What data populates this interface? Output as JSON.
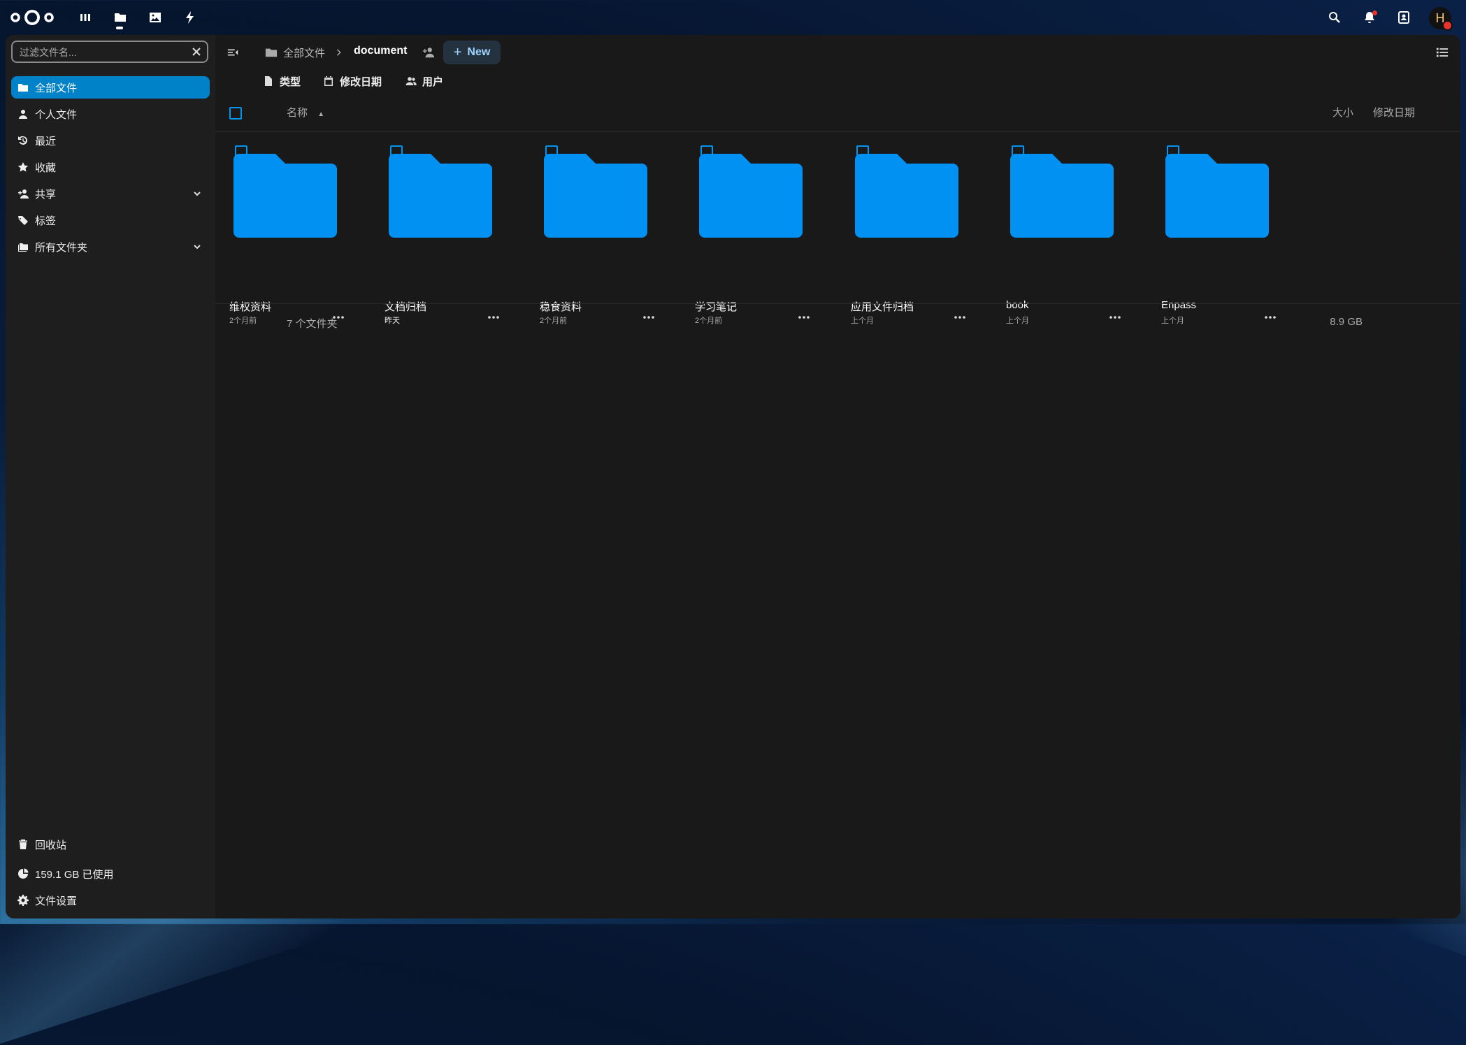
{
  "header": {
    "apps": [
      {
        "name": "dashboard",
        "icon": "dashboard-icon"
      },
      {
        "name": "files",
        "icon": "folder-icon"
      },
      {
        "name": "photos",
        "icon": "photo-icon"
      },
      {
        "name": "activity",
        "icon": "lightning-icon"
      }
    ],
    "avatar_initial": "H",
    "right_icons": [
      "search-icon",
      "bell-icon",
      "contacts-icon"
    ]
  },
  "sidebar": {
    "filter_placeholder": "过滤文件名...",
    "items": [
      {
        "label": "全部文件",
        "icon": "folder-icon",
        "active": true
      },
      {
        "label": "个人文件",
        "icon": "user-icon"
      },
      {
        "label": "最近",
        "icon": "history-icon"
      },
      {
        "label": "收藏",
        "icon": "star-icon"
      },
      {
        "label": "共享",
        "icon": "share-icon",
        "expandable": true
      },
      {
        "label": "标签",
        "icon": "tag-icon"
      },
      {
        "label": "所有文件夹",
        "icon": "folders-icon",
        "expandable": true
      }
    ],
    "footer": {
      "trash": "回收站",
      "quota": "159.1 GB 已使用",
      "settings": "文件设置"
    }
  },
  "breadcrumb": {
    "root": "全部文件",
    "current": "document",
    "new_label": "New"
  },
  "filters": {
    "type": "类型",
    "modified": "修改日期",
    "user": "用户"
  },
  "columns": {
    "name": "名称",
    "size": "大小",
    "modified": "修改日期"
  },
  "folders": [
    {
      "name": "维权资料",
      "date": "2个月前"
    },
    {
      "name": "文档归档",
      "date": "昨天"
    },
    {
      "name": "稳食资料",
      "date": "2个月前"
    },
    {
      "name": "学习笔记",
      "date": "2个月前"
    },
    {
      "name": "应用文件归档",
      "date": "上个月"
    },
    {
      "name": "book",
      "date": "上个月"
    },
    {
      "name": "Enpass",
      "date": "上个月"
    }
  ],
  "summary": {
    "count": "7 个文件夹",
    "size": "8.9 GB"
  },
  "colors": {
    "accent": "#0082c9",
    "folder": "#0091f2"
  }
}
